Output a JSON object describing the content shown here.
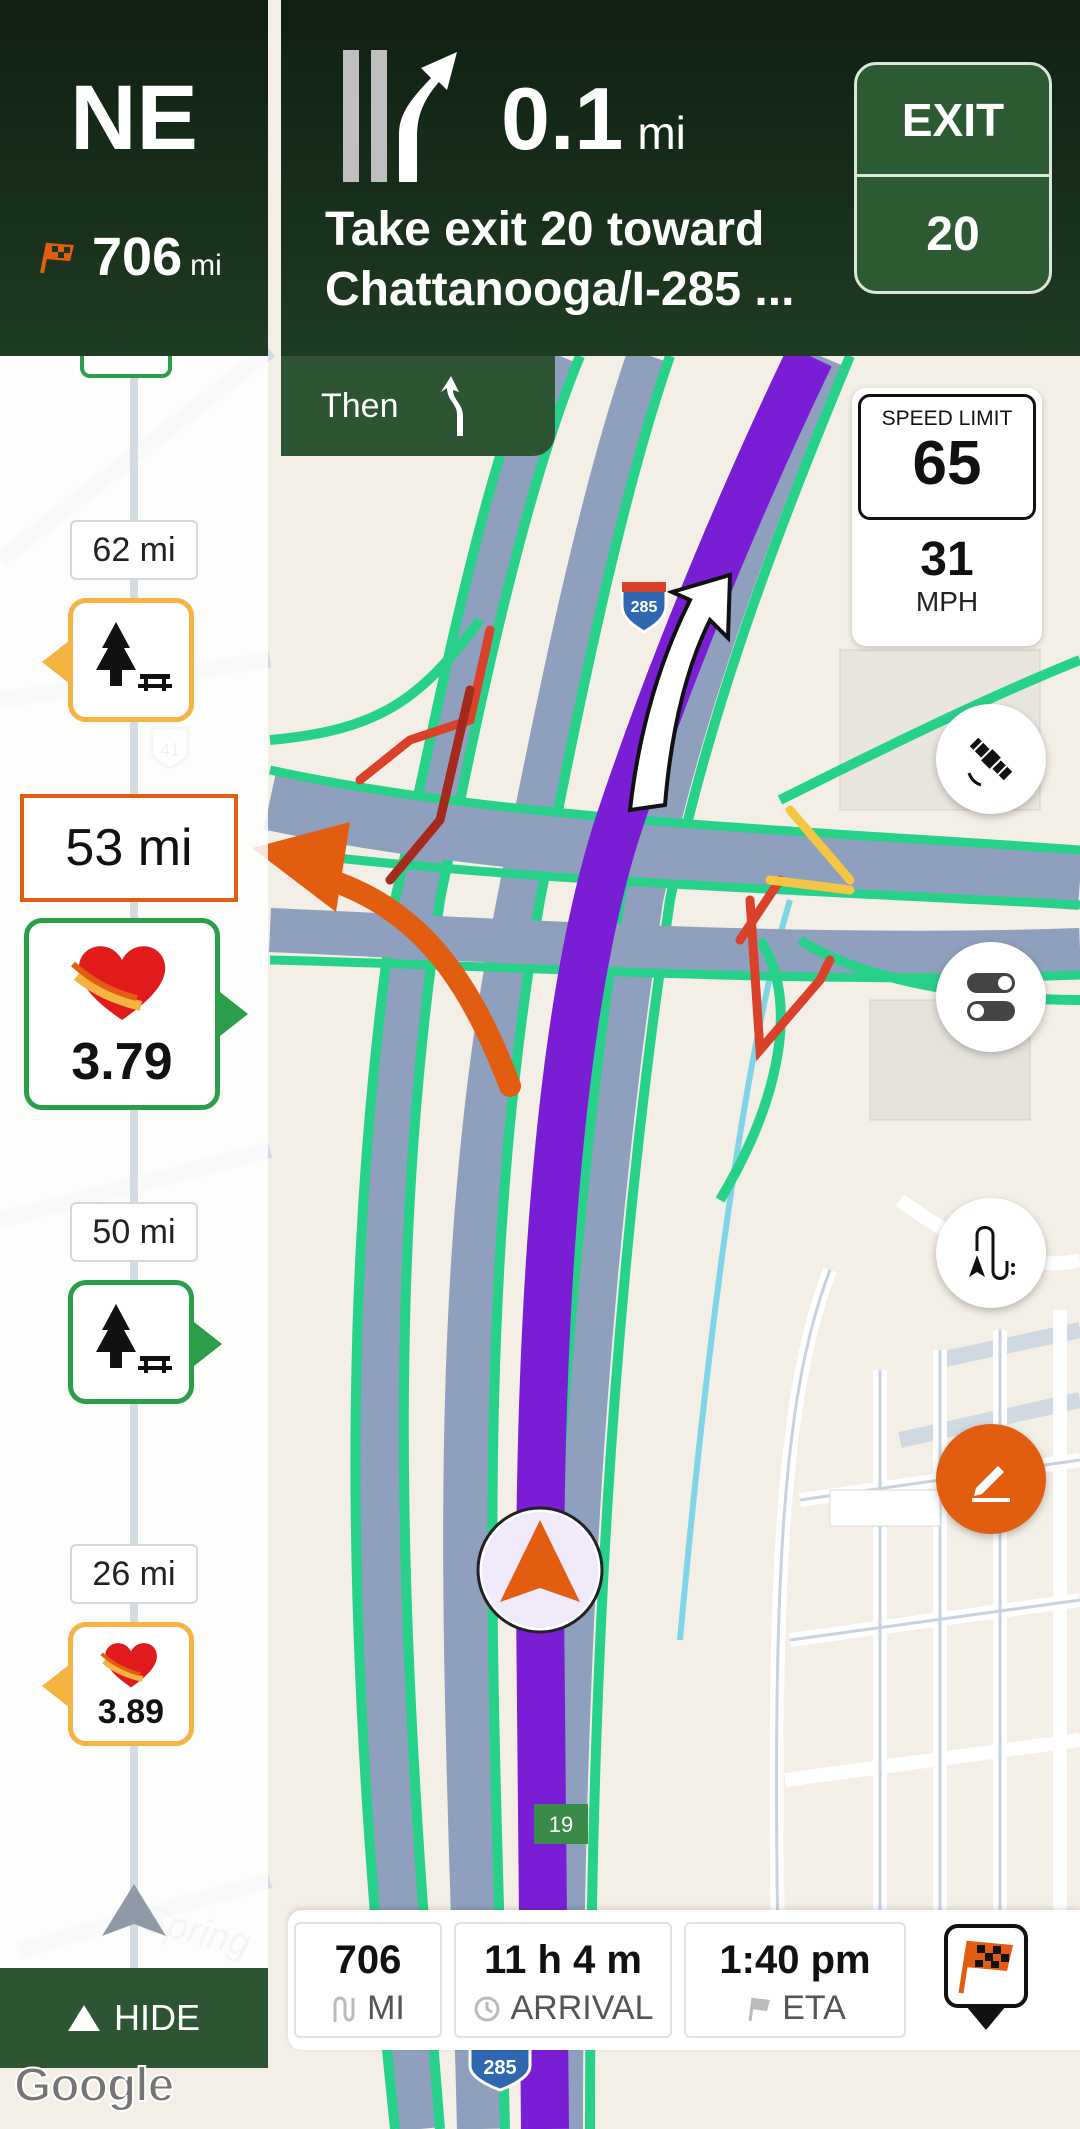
{
  "colors": {
    "panel_dark": "#1b3520",
    "accent_green": "#2d5533",
    "route_purple": "#7a1ed6",
    "traffic_green": "#27d18a",
    "traffic_red": "#d9412b",
    "traffic_yellow": "#f5c644",
    "highlight_orange": "#e35d10",
    "gas_orange_border": "#f5b342",
    "poi_green_border": "#2b9e4a"
  },
  "heading": {
    "direction": "NE",
    "remaining_value": "706",
    "remaining_unit": "mi",
    "flag_icon": "checkered-flag-icon"
  },
  "instruction": {
    "distance_value": "0.1",
    "distance_unit": "mi",
    "text_line1": "Take exit 20 toward",
    "text_line2": "Chattanooga/I-285 ...",
    "lane_icon": "exit-right-lane-icon",
    "exit_label": "EXIT",
    "exit_number": "20",
    "then_label": "Then",
    "then_icon": "keep-left-arrow-icon"
  },
  "sidebar": {
    "items": [
      {
        "distance": "62 mi",
        "type": "rest-area",
        "icon": "rest-area-icon"
      },
      {
        "distance": "53 mi",
        "type": "gas-station",
        "price": "3.79",
        "icon": "heart-gas-icon",
        "highlighted": true
      },
      {
        "distance": "50 mi",
        "type": "rest-area",
        "icon": "rest-area-icon"
      },
      {
        "distance": "26 mi",
        "type": "gas-station",
        "price": "3.89",
        "icon": "heart-gas-icon"
      }
    ],
    "hide_label": "HIDE"
  },
  "speed": {
    "limit_label": "SPEED LIMIT",
    "limit_value": "65",
    "current_value": "31",
    "current_unit": "MPH"
  },
  "map": {
    "highway_shield": "285",
    "exit_marker": "19",
    "road_shield_41": "41",
    "bottom_shield": "285",
    "street_label": "Spring",
    "attribution": "Google"
  },
  "map_controls": {
    "satellite_icon": "satellite-icon",
    "toggle_icon": "toggle-switch-icon",
    "route_icon": "route-overview-icon",
    "edit_icon": "pencil-icon"
  },
  "trip_stats": [
    {
      "value": "706",
      "label": "MI",
      "icon": "route-distance-icon"
    },
    {
      "value": "11 h 4 m",
      "label": "ARRIVAL",
      "icon": "clock-icon"
    },
    {
      "value": "1:40 pm",
      "label": "ETA",
      "icon": "flag-icon"
    }
  ]
}
